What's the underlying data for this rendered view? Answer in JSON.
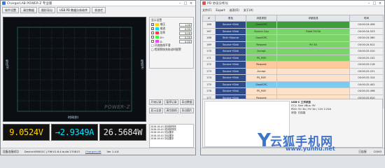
{
  "main_window": {
    "title": "ChargerLAB POWER-Z 专业版",
    "toolbar": [
      "软件设置",
      "清空数据",
      "图形导出",
      "USB PD 数据分析软件",
      "状态栏"
    ],
    "plot": {
      "left_axis_label": "电压(V)",
      "right_axis_label": "电流(A)",
      "x_axis_label": "时间(秒)",
      "logo_text": "POWER-Z",
      "colors": {
        "background": "#0b0f14",
        "grid": "#2f7a62",
        "voltage": "#ffd400",
        "current": "#00e5ff"
      }
    },
    "display_group": {
      "title": "显示设置",
      "rows": [
        {
          "label": "电压",
          "checked": true,
          "color": "#ffd400",
          "value": "1.00"
        },
        {
          "label": "电流",
          "checked": true,
          "color": "#00e5ff",
          "value": "0.50"
        },
        {
          "label": "功率",
          "checked": false,
          "color": "#ff4040",
          "value": "5.00"
        },
        {
          "label": "D+",
          "checked": false,
          "color": "#40ff40",
          "value": "0.50"
        },
        {
          "label": "D-",
          "checked": false,
          "color": "#ff40ff",
          "value": "0.50"
        }
      ],
      "options": [
        "□ 开启曲线平滑",
        "□ 检测到快充协议时报警"
      ]
    },
    "buttons": [
      "开始记录",
      "暂停记录",
      "导出数据",
      "显示全部",
      "清空曲线",
      "导出图片"
    ],
    "readouts": {
      "voltage": {
        "text": "9.0524V",
        "color": "#ffd400"
      },
      "current": {
        "text": "→2.9349A",
        "color": "#00e5ff"
      },
      "power": {
        "text": "26.5684W",
        "color": "#e6e6e6"
      }
    },
    "log_lines": [
      "2018-05-01 检测到快充",
      "2018-05-01 检测到快充",
      "2018-05-01 协议握手",
      "2018-05-01 协议握手",
      "2018-05-01 协议握手"
    ],
    "status": {
      "left": "设备连接成功",
      "device": "Device:KM001C | FW:V1.6.4 build 270813",
      "link": "ChargerLAB",
      "version": "Ver 1.4.8"
    }
  },
  "pd_window": {
    "title": "PD 协议分析仪",
    "toolbar": [
      "文件(F)",
      "Export",
      "选项(O)",
      "关于(A)"
    ],
    "columns": [
      "#",
      "角色",
      "消息类型",
      "详细信息",
      "时间"
    ],
    "rows": [
      {
        "no": "166",
        "role": "Source→Sink",
        "type": "GoodCRC",
        "detail": "",
        "time": "00:00:24.456",
        "bg": "#3d9e3a"
      },
      {
        "no": "167",
        "role": "Source→Sink",
        "type": "Source Cap",
        "detail": "Fixed 5V/3A",
        "time": "00:00:24.523",
        "bg": "#7cd36a"
      },
      {
        "no": "168",
        "role": "Sink→Source",
        "type": "GoodCRC",
        "detail": "",
        "time": "00:00:24.560",
        "bg": "#7cd36a"
      },
      {
        "no": "169",
        "role": "Source→Sink",
        "type": "Request",
        "detail": "9V 3A",
        "time": "00:00:24.612",
        "bg": "#7cd36a"
      },
      {
        "no": "170",
        "role": "Source→Sink",
        "type": "Accept",
        "detail": "",
        "time": "00:00:25.010",
        "bg": "#7cd36a"
      },
      {
        "no": "171",
        "role": "Source→Sink",
        "type": "PS_RDY",
        "detail": "",
        "time": "00:00:25.102",
        "bg": "#7cd36a"
      },
      {
        "no": "172",
        "role": "Source→Sink",
        "type": "Request",
        "detail": "",
        "time": "00:00:25.118",
        "bg": "#ffc9a0"
      },
      {
        "no": "173",
        "role": "Source→Sink",
        "type": "Accept",
        "detail": "",
        "time": "00:00:25.221",
        "bg": "#ffe2c8"
      },
      {
        "no": "174",
        "role": "Source→Sink",
        "type": "PS_RDY",
        "detail": "",
        "time": "00:00:25.314",
        "bg": "#ffe2c8"
      },
      {
        "no": "175",
        "role": "Source→Sink",
        "type": "GoodCRC",
        "detail": "",
        "time": "00:00:25.402",
        "bg": "#7ec9f0"
      },
      {
        "no": "176",
        "role": "Source→Sink",
        "type": "PS_RDY",
        "detail": "",
        "time": "00:00:25.498",
        "bg": "#ffe2c8"
      },
      {
        "no": "177",
        "role": "Source→Sink",
        "type": "Request",
        "detail": "",
        "time": "00:00:25.610",
        "bg": "#ffe2c8"
      },
      {
        "no": "178",
        "role": "Source→Sink",
        "type": "Accept",
        "detail": "",
        "time": "00:00:25.712",
        "bg": "#ffe2c8"
      }
    ],
    "lower_panel": {
      "title": "USB-C 工作状态",
      "lines": [
        "CC1: Sink   VBus: 9V",
        "PDO: 5V 3A / 9V 3A / 12V 2.25A",
        "状态: 已连接"
      ]
    },
    "status": [
      "已连接",
      "COM3"
    ]
  },
  "watermark": {
    "zh": "云狐手机网",
    "url": "www.yunhu.net",
    "letter": "Y"
  }
}
